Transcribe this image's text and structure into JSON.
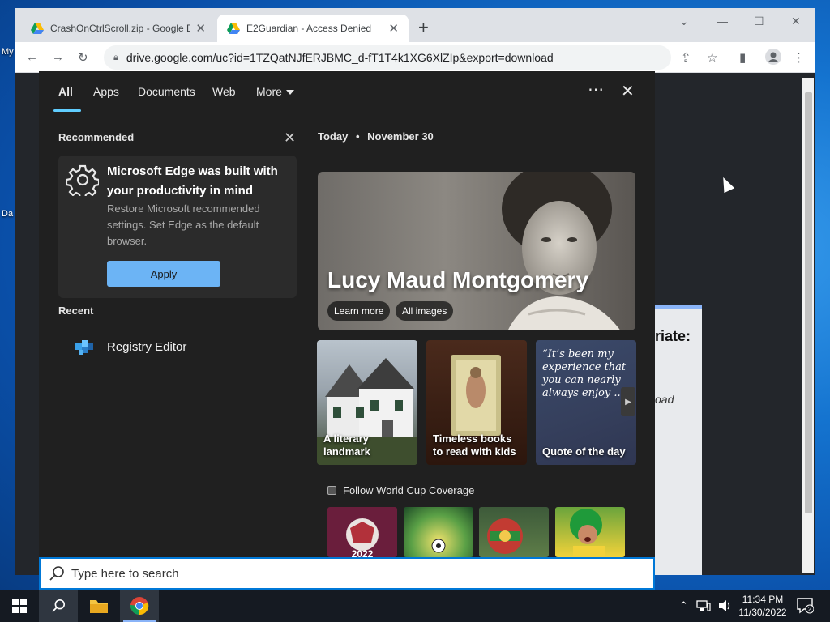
{
  "desktop": {
    "labels": [
      "My",
      "Da"
    ]
  },
  "browser": {
    "tabs": [
      {
        "title": "CrashOnCtrlScroll.zip - Google Drive",
        "active": false
      },
      {
        "title": "E2Guardian - Access Denied",
        "active": true
      }
    ],
    "address": "drive.google.com/uc?id=1TZQatNJfERJBMC_d-fT1T4k1XG6XlZIp&export=download",
    "page_fragments": {
      "heading_fragment": "riate:",
      "link_fragment": "oad"
    }
  },
  "search_panel": {
    "nav": {
      "items": [
        "All",
        "Apps",
        "Documents",
        "Web",
        "More"
      ]
    },
    "recommended": {
      "section_title": "Recommended",
      "card_title": "Microsoft Edge was built with your productivity in mind",
      "card_desc": "Restore Microsoft recommended settings. Set Edge as the default browser.",
      "apply_label": "Apply"
    },
    "recent": {
      "section_title": "Recent",
      "items": [
        "Registry Editor"
      ]
    },
    "today": {
      "label": "Today",
      "separator": "•",
      "date": "November 30",
      "hero_title": "Lucy Maud Montgomery",
      "hero_buttons": [
        "Learn more",
        "All images"
      ],
      "tiles": [
        {
          "caption": "A literary landmark"
        },
        {
          "caption": "Timeless books to read with kids"
        },
        {
          "caption": "Quote of the day",
          "quote": "“It’s been my experience that you can nearly always enjoy ..."
        }
      ],
      "world_cup_title": "Follow World Cup Coverage",
      "world_cup_badge": "2022"
    }
  },
  "searchbox": {
    "placeholder": "Type here to search"
  },
  "taskbar": {
    "clock_time": "11:34 PM",
    "clock_date": "11/30/2022",
    "notification_count": "2"
  },
  "colors": {
    "accent": "#60cdff",
    "apply_button": "#6cb4f5",
    "panel_bg": "#202020",
    "taskbar_bg": "#151a22",
    "search_border": "#0078d7"
  }
}
